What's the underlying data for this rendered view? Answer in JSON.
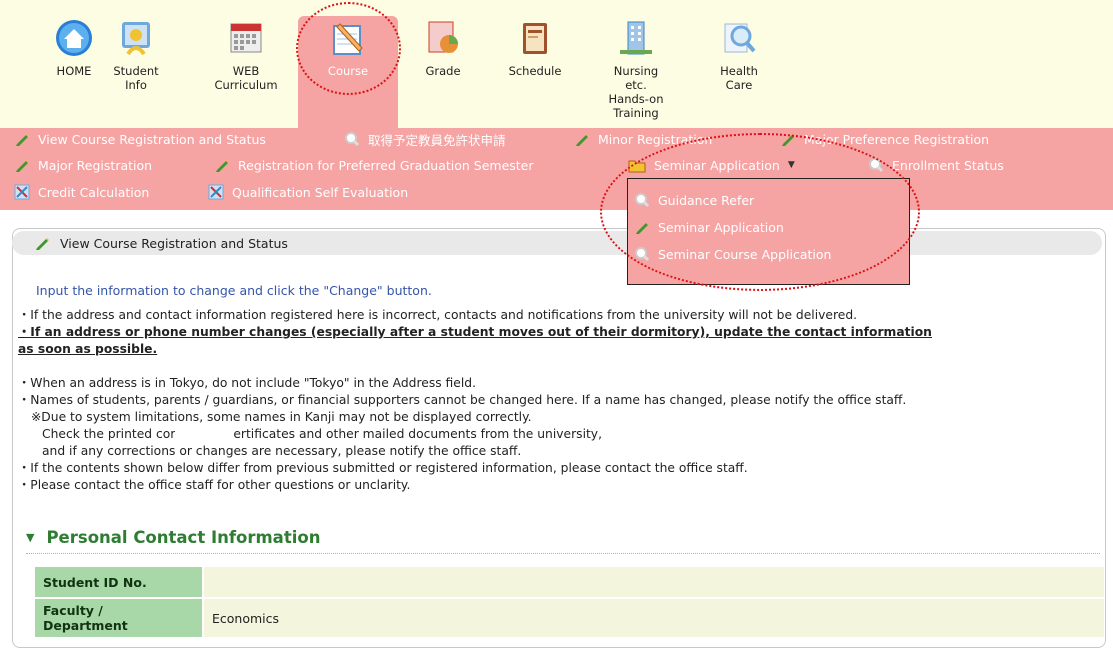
{
  "nav": {
    "home": "HOME",
    "student_info": "Student Info",
    "web_curriculum_1": "WEB",
    "web_curriculum_2": "Curriculum",
    "course": "Course",
    "grade": "Grade",
    "schedule": "Schedule",
    "nursing_1": "Nursing etc.",
    "nursing_2": "Hands-on",
    "nursing_3": "Training",
    "health_care": "Health Care"
  },
  "submenu": {
    "view_course": "View Course Registration and Status",
    "kyoin": "取得予定教員免許状申請",
    "minor": "Minor Registration",
    "major_pref": "Major Preference Registration",
    "major_reg": "Major Registration",
    "grad_semester": "Registration for Preferred Graduation Semester",
    "seminar_app": "Seminar Application",
    "enrollment": "Enrollment Status",
    "credit": "Credit Calculation",
    "qual_eval": "Qualification Self Evaluation"
  },
  "dropdown": {
    "guidance": "Guidance Refer",
    "seminar_app": "Seminar Application",
    "seminar_course": "Seminar Course Application"
  },
  "panel": {
    "title": "View Course Registration and Status",
    "instruction": "Input the information to change and click the \"Change\" button."
  },
  "notes": {
    "n1": "・If the address and contact information registered here is incorrect, contacts and notifications from the university will not be delivered.",
    "n2a": "・If an address or phone number changes (especially after a student moves out of their dormitory), update the contact information",
    "n2b": "as soon as possible.",
    "n3": "・When an address is in Tokyo, do not include \"Tokyo\" in the Address field.",
    "n4": "・Names of students, parents / guardians, or financial supporters cannot be changed here. If a name has changed, please notify the office staff.",
    "n5": "※Due to system limitations, some names in Kanji may not be displayed correctly.",
    "n6a": "Check the printed cor",
    "n6b": "ertificates and other mailed documents from the university,",
    "n7": "and if any corrections or changes are necessary, please notify the office staff.",
    "n8": "・If the contents shown below differ from previous submitted or registered information, please contact the office staff.",
    "n9": "・Please contact the office staff for other questions or unclarity."
  },
  "section": {
    "title": "Personal Contact Information"
  },
  "table": {
    "student_id_label": "Student ID No.",
    "student_id_value": "",
    "faculty_label_1": "Faculty /",
    "faculty_label_2": "Department",
    "faculty_value": "Economics"
  },
  "colors": {
    "menu_pink": "#f6a3a3",
    "topbar": "#fdfde3",
    "section_green": "#2e7d32",
    "label_green": "#a8d8a8"
  }
}
